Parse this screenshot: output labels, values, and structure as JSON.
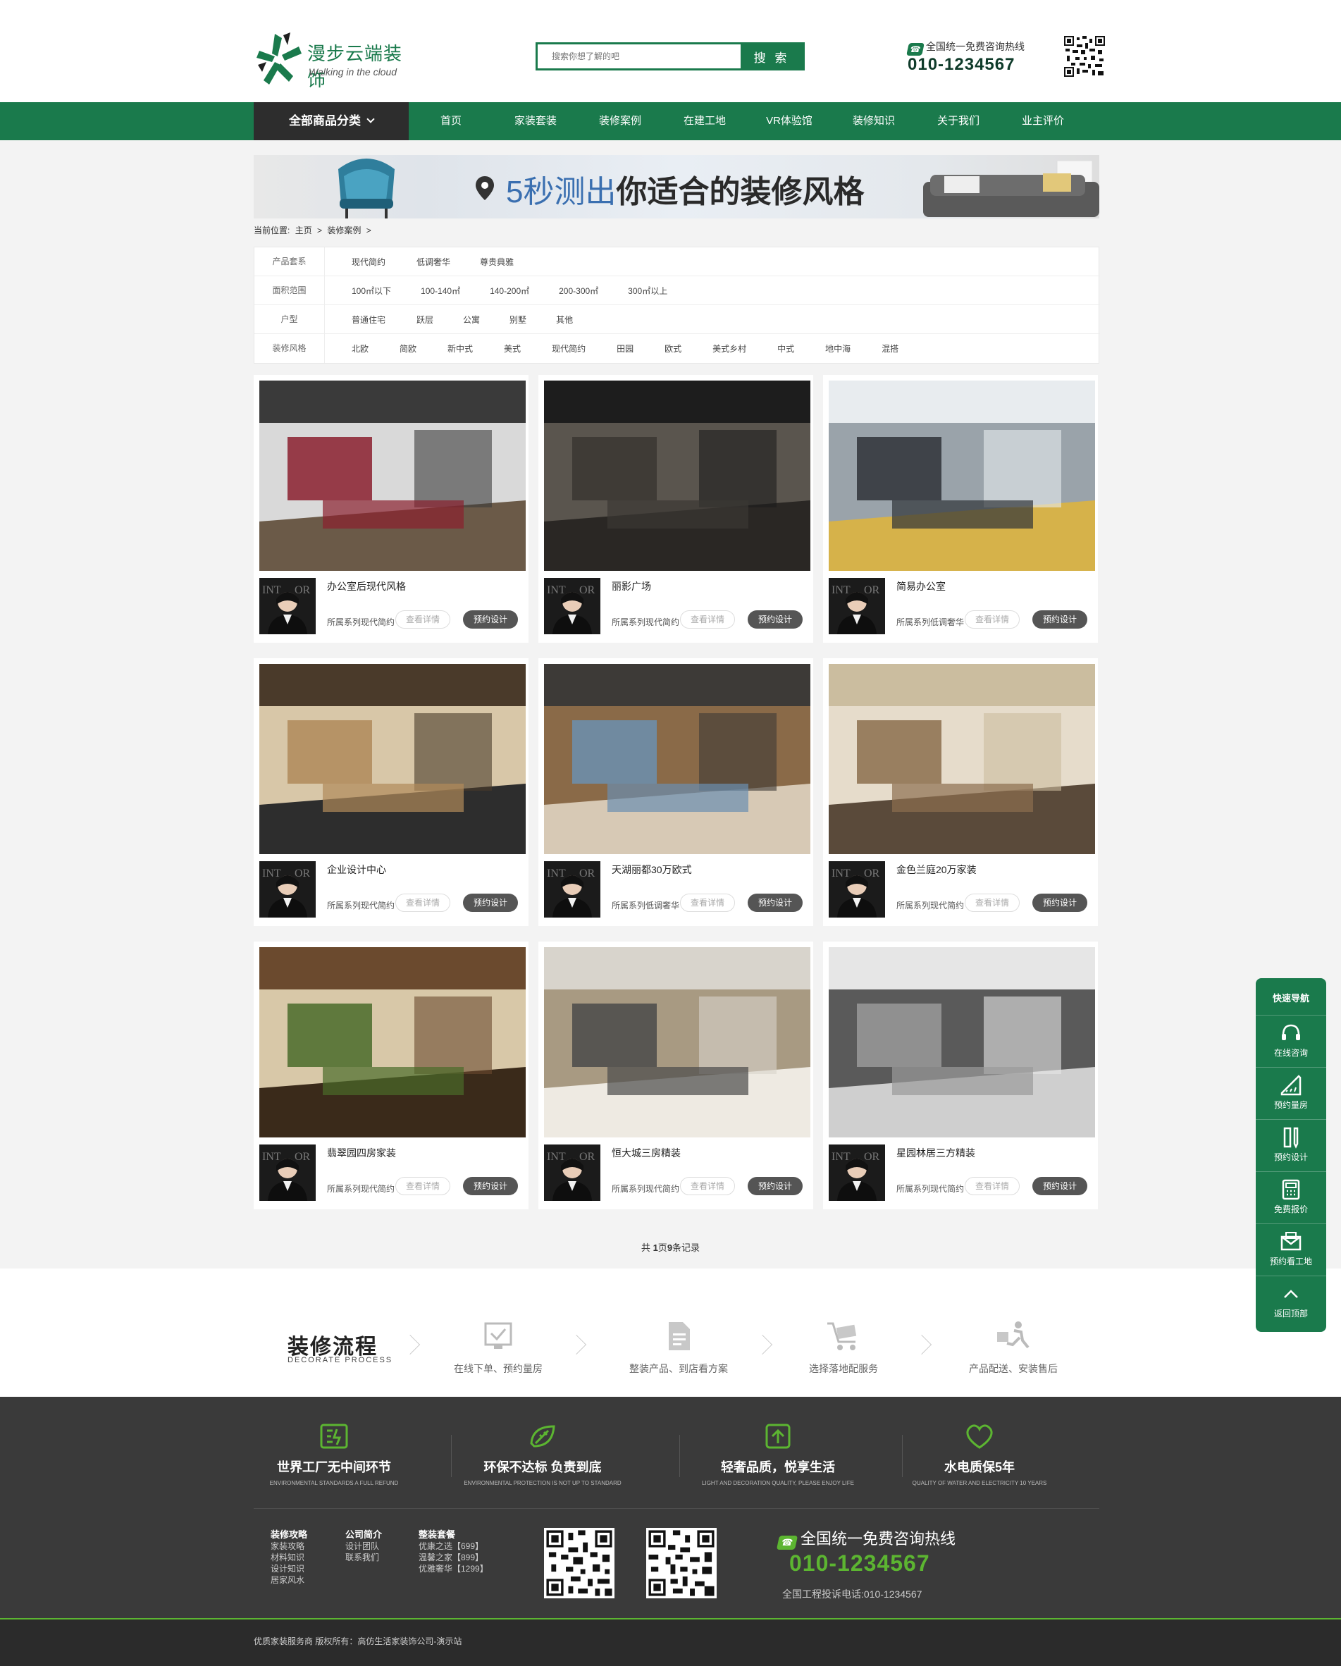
{
  "brand": {
    "name_cn": "漫步云端装饰",
    "name_en": "Walking in the cloud",
    "accent": "#1a7a4c",
    "footer_accent": "#5cb531"
  },
  "search": {
    "placeholder": "搜索你想了解的吧",
    "button": "搜 索"
  },
  "hotline": {
    "label": "全国统一免费咨询热线",
    "number": "010-1234567"
  },
  "nav": {
    "category": "全部商品分类",
    "items": [
      "首页",
      "家装套装",
      "装修案例",
      "在建工地",
      "VR体验馆",
      "装修知识",
      "关于我们",
      "业主评价"
    ]
  },
  "banner": {
    "text_a": "5秒测出",
    "text_b": "你适合的装修风格"
  },
  "breadcrumb": {
    "label": "当前位置:",
    "items": [
      "主页",
      ">",
      "装修案例",
      ">"
    ]
  },
  "filters": [
    {
      "label": "产品套系",
      "options": [
        "现代简约",
        "低调奢华",
        "尊贵典雅"
      ]
    },
    {
      "label": "面积范围",
      "options": [
        "100㎡以下",
        "100-140㎡",
        "140-200㎡",
        "200-300㎡",
        "300㎡以上"
      ]
    },
    {
      "label": "户型",
      "options": [
        "普通住宅",
        "跃层",
        "公寓",
        "别墅",
        "其他"
      ]
    },
    {
      "label": "装修风格",
      "options": [
        "北欧",
        "简欧",
        "新中式",
        "美式",
        "现代简约",
        "田园",
        "欧式",
        "美式乡村",
        "中式",
        "地中海",
        "混搭"
      ]
    }
  ],
  "cases": [
    {
      "title": "办公室后现代风格",
      "series": "所属系列现代简约",
      "detail": "查看详情",
      "design": "预约设计"
    },
    {
      "title": "丽影广场",
      "series": "所属系列现代简约",
      "detail": "查看详情",
      "design": "预约设计"
    },
    {
      "title": "简易办公室",
      "series": "所属系列低调奢华",
      "detail": "查看详情",
      "design": "预约设计"
    },
    {
      "title": "企业设计中心",
      "series": "所属系列现代简约",
      "detail": "查看详情",
      "design": "预约设计"
    },
    {
      "title": "天湖丽都30万欧式",
      "series": "所属系列低调奢华",
      "detail": "查看详情",
      "design": "预约设计"
    },
    {
      "title": "金色兰庭20万家装",
      "series": "所属系列现代简约",
      "detail": "查看详情",
      "design": "预约设计"
    },
    {
      "title": "翡翠园四房家装",
      "series": "所属系列现代简约",
      "detail": "查看详情",
      "design": "预约设计"
    },
    {
      "title": "恒大城三房精装",
      "series": "所属系列现代简约",
      "detail": "查看详情",
      "design": "预约设计"
    },
    {
      "title": "星园林居三方精装",
      "series": "所属系列现代简约",
      "detail": "查看详情",
      "design": "预约设计"
    }
  ],
  "pager": {
    "prefix": "共",
    "pages": "1",
    "mid": "页",
    "records": "9",
    "suffix": "条记录"
  },
  "process": {
    "title": "装修流程",
    "subtitle": "DECORATE  PROCESS",
    "steps": [
      "在线下单、预约量房",
      "整装产品、到店看方案",
      "选择落地配服务",
      "产品配送、安装售后"
    ]
  },
  "features": [
    {
      "title": "世界工厂无中间环节",
      "sub": "ENVIRONMENTAL STANDARDS A FULL REFUND"
    },
    {
      "title": "环保不达标  负责到底",
      "sub": "ENVIRONMENTAL PROTECTION IS NOT UP TO STANDARD"
    },
    {
      "title": "轻奢品质，悦享生活",
      "sub": "LIGHT AND DECORATION QUALITY, PLEASE ENJOY LIFE"
    },
    {
      "title": "水电质保5年",
      "sub": "QUALITY OF WATER AND ELECTRICITY 10 YEARS"
    }
  ],
  "footer_links": [
    {
      "head": "装修攻略",
      "items": [
        "家装攻略",
        "材料知识",
        "设计知识",
        "居家风水"
      ]
    },
    {
      "head": "公司简介",
      "items": [
        "设计团队",
        "联系我们"
      ]
    },
    {
      "head": "整装套餐",
      "items": [
        "优康之选【699】",
        "温馨之家【899】",
        "优雅奢华【1299】"
      ]
    }
  ],
  "footer_hotline": {
    "label": "全国统一免费咨询热线",
    "number": "010-1234567",
    "complaint": "全国工程投诉电话:010-1234567"
  },
  "copyright": "优质家装服务商 版权所有：高仿生活家装饰公司-演示站",
  "side_nav": {
    "title": "快速导航",
    "items": [
      "在线咨询",
      "预约量房",
      "预约设计",
      "免费报价",
      "预约看工地",
      "返回顶部"
    ]
  }
}
